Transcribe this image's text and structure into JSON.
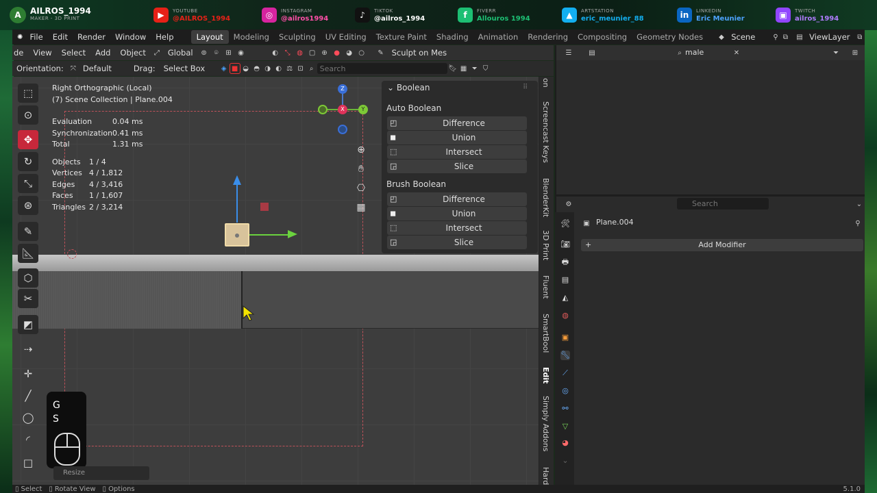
{
  "social": {
    "brand": "AILROS_1994",
    "brand_sub": "MAKER - 3D PRINT",
    "items": [
      {
        "platform": "YOUTUBE",
        "handle": "@AILROS_1994",
        "color": "#e62117"
      },
      {
        "platform": "INSTAGRAM",
        "handle": "@ailros1994",
        "color": "#d6249f"
      },
      {
        "platform": "TIKTOK",
        "handle": "@ailros_1994",
        "color": "#111111"
      },
      {
        "platform": "FIVERR",
        "handle": "Allouros 1994",
        "color": "#1dbf73"
      },
      {
        "platform": "ARTSTATION",
        "handle": "eric_meunier_88",
        "color": "#13aff0"
      },
      {
        "platform": "LINKEDIN",
        "handle": "Eric Meunier",
        "color": "#0a66c2"
      },
      {
        "platform": "TWITCH",
        "handle": "ailros_1994",
        "color": "#9146ff"
      }
    ]
  },
  "menu": {
    "items": [
      "File",
      "Edit",
      "Render",
      "Window",
      "Help"
    ],
    "workspaces": [
      "Layout",
      "Modeling",
      "Sculpting",
      "UV Editing",
      "Texture Paint",
      "Shading",
      "Animation",
      "Rendering",
      "Compositing",
      "Geometry Nodes"
    ],
    "active_workspace": "Layout",
    "scene": "Scene",
    "view_layer": "ViewLayer"
  },
  "viewport_header": {
    "mode": "de",
    "view": "View",
    "select": "Select",
    "add": "Add",
    "object": "Object",
    "transform": "Global",
    "sculpt": "Sculpt on Mes"
  },
  "tool_header": {
    "orientation_label": "Orientation:",
    "orientation": "Default",
    "drag_label": "Drag:",
    "drag": "Select Box",
    "search_placeholder": "Search"
  },
  "overlay": {
    "view_name": "Right Orthographic (Local)",
    "collection": "(7) Scene Collection | Plane.004",
    "timing": [
      {
        "k": "Evaluation",
        "v": "0.04 ms"
      },
      {
        "k": "Synchronization",
        "v": "0.41 ms"
      },
      {
        "k": "Total",
        "v": "1.31 ms"
      }
    ],
    "stats": [
      {
        "k": "Objects",
        "v": "1 / 4"
      },
      {
        "k": "Vertices",
        "v": "4 / 1,812"
      },
      {
        "k": "Edges",
        "v": "4 / 3,416"
      },
      {
        "k": "Faces",
        "v": "1 / 1,607"
      },
      {
        "k": "Triangles",
        "v": "2 / 3,214"
      }
    ]
  },
  "gizmo": {
    "z": "Z",
    "x": "X",
    "y": "Y"
  },
  "boolean_panel": {
    "title": "Boolean",
    "auto_title": "Auto Boolean",
    "auto": [
      "Difference",
      "Union",
      "Intersect",
      "Slice"
    ],
    "brush_title": "Brush Boolean",
    "brush": [
      "Difference",
      "Union",
      "Intersect",
      "Slice"
    ]
  },
  "n_tabs": [
    "on",
    "Screencast Keys",
    "BlenderKit",
    "3D Print",
    "Fluent",
    "SmartBool",
    "Edit",
    "Simply Addons",
    "Hard"
  ],
  "outliner": {
    "search_value": "male"
  },
  "properties": {
    "search_placeholder": "Search",
    "object_name": "Plane.004",
    "add_modifier": "Add Modifier"
  },
  "keycast": {
    "keys": [
      "G",
      "S"
    ]
  },
  "last_op": "Resize",
  "status": {
    "select": "Select",
    "rotate": "Rotate View",
    "options": "Options",
    "version": "5.1.0"
  }
}
